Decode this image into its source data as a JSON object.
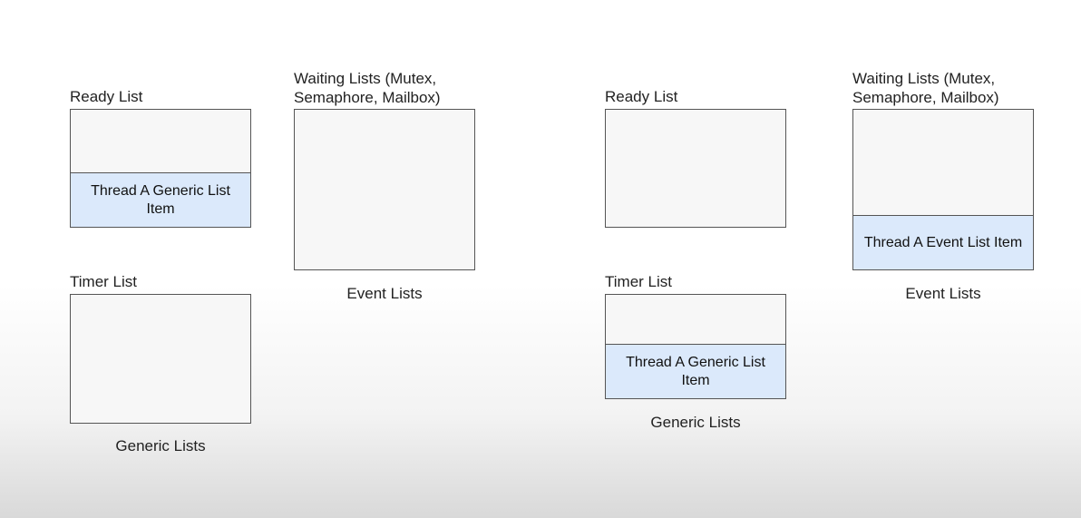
{
  "left": {
    "readyList": {
      "label": "Ready List",
      "item": "Thread A Generic\nList Item"
    },
    "timerList": {
      "label": "Timer List",
      "item": null
    },
    "genericCaption": "Generic Lists",
    "waitingLists": {
      "label": "Waiting Lists (Mutex,\nSemaphore, Mailbox)",
      "item": null
    },
    "eventCaption": "Event Lists"
  },
  "right": {
    "readyList": {
      "label": "Ready List",
      "item": null
    },
    "timerList": {
      "label": "Timer List",
      "item": "Thread A Generic\nList Item"
    },
    "genericCaption": "Generic Lists",
    "waitingLists": {
      "label": "Waiting Lists (Mutex,\nSemaphore, Mailbox)",
      "item": "Thread A Event List\nItem"
    },
    "eventCaption": "Event Lists"
  }
}
